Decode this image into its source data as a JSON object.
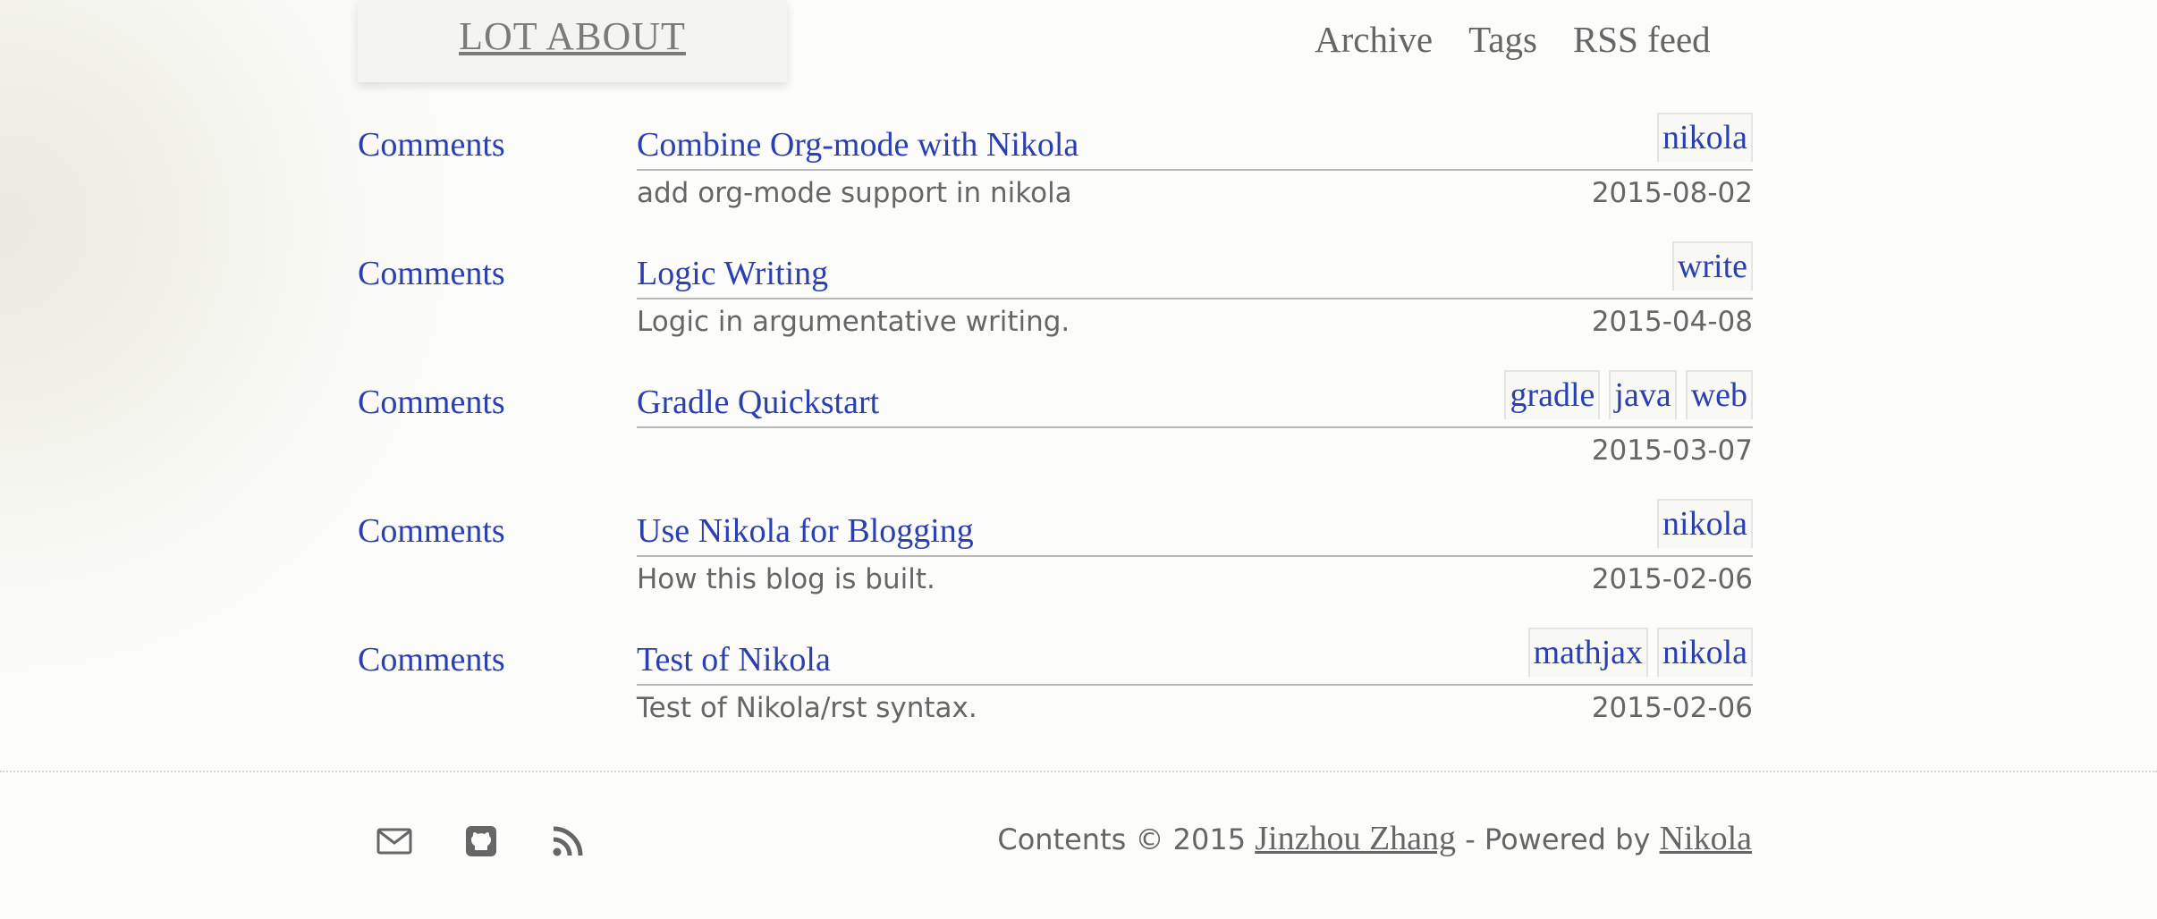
{
  "site": {
    "title": "LOT ABOUT",
    "nav": [
      "Archive",
      "Tags",
      "RSS feed"
    ]
  },
  "posts": [
    {
      "comments": "Comments",
      "title": "Combine Org-mode with Nikola",
      "description": "add org-mode support in nikola",
      "date": "2015-08-02",
      "tags": [
        "nikola"
      ]
    },
    {
      "comments": "Comments",
      "title": "Logic Writing",
      "description": "Logic in argumentative writing.",
      "date": "2015-04-08",
      "tags": [
        "write"
      ]
    },
    {
      "comments": "Comments",
      "title": "Gradle Quickstart",
      "description": "",
      "date": "2015-03-07",
      "tags": [
        "gradle",
        "java",
        "web"
      ]
    },
    {
      "comments": "Comments",
      "title": "Use Nikola for Blogging",
      "description": "How this blog is built.",
      "date": "2015-02-06",
      "tags": [
        "nikola"
      ]
    },
    {
      "comments": "Comments",
      "title": "Test of Nikola",
      "description": "Test of Nikola/rst syntax.",
      "date": "2015-02-06",
      "tags": [
        "mathjax",
        "nikola"
      ]
    }
  ],
  "footer": {
    "icons": [
      "mail-icon",
      "github-icon",
      "rss-icon"
    ],
    "prefix": "Contents © 2015 ",
    "author": "Jinzhou Zhang",
    "middle": " - Powered by ",
    "engine": "Nikola"
  },
  "colors": {
    "link": "#2a3fb0",
    "text": "#666666"
  }
}
